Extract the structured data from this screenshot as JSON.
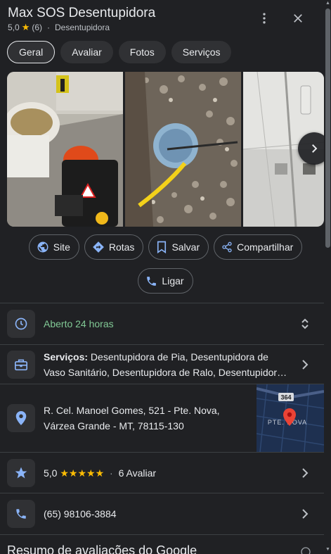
{
  "place": {
    "name": "Max SOS Desentupidora",
    "rating": "5,0",
    "review_count": "(6)",
    "category": "Desentupidora"
  },
  "tabs": [
    {
      "label": "Geral",
      "active": true
    },
    {
      "label": "Avaliar",
      "active": false
    },
    {
      "label": "Fotos",
      "active": false
    },
    {
      "label": "Serviços",
      "active": false
    }
  ],
  "actions": {
    "site": "Site",
    "rotas": "Rotas",
    "salvar": "Salvar",
    "compartilhar": "Compartilhar",
    "ligar": "Ligar"
  },
  "info": {
    "hours": "Aberto 24 horas",
    "services_label": "Serviços:",
    "services_text": " Desentupidora de Pia, Desentupidora de Vaso Sanitário, Desentupidora de Ralo, Desentupidora de Esgoto",
    "address_line1": "R. Cel. Manoel Gomes, 521 - Pte. Nova,",
    "address_line2": "Várzea Grande - MT, 78115-130",
    "rating": "5,0",
    "stars": "★★★★★",
    "reviews_link": "6 Avaliar",
    "phone": "(65) 98106-3884"
  },
  "map": {
    "road_number": "364",
    "area_label": "PTE. NOVA"
  },
  "next_section_title": "Resumo de avaliações do Google",
  "colors": {
    "background": "#202124",
    "accent": "#8ab4f8",
    "open_green": "#81c995",
    "star_yellow": "#fbbc04",
    "pin_red": "#ea4335"
  }
}
